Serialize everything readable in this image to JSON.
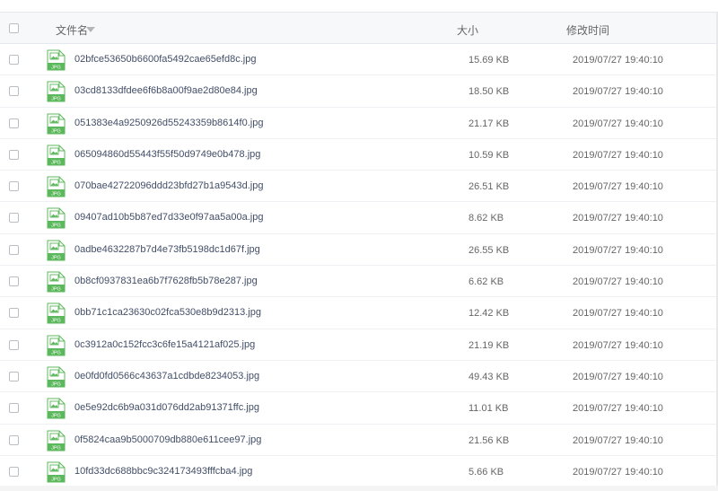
{
  "header": {
    "name_label": "文件名",
    "size_label": "大小",
    "time_label": "修改时间"
  },
  "icon": {
    "name": "jpg-file-icon",
    "badge": "JPG",
    "color": "#5cb85c"
  },
  "files": [
    {
      "name": "02bfce53650b6600fa5492cae65efd8c.jpg",
      "size": "15.69 KB",
      "time": "2019/07/27 19:40:10"
    },
    {
      "name": "03cd8133dfdee6f6b8a00f9ae2d80e84.jpg",
      "size": "18.50 KB",
      "time": "2019/07/27 19:40:10"
    },
    {
      "name": "051383e4a9250926d55243359b8614f0.jpg",
      "size": "21.17 KB",
      "time": "2019/07/27 19:40:10"
    },
    {
      "name": "065094860d55443f55f50d9749e0b478.jpg",
      "size": "10.59 KB",
      "time": "2019/07/27 19:40:10"
    },
    {
      "name": "070bae42722096ddd23bfd27b1a9543d.jpg",
      "size": "26.51 KB",
      "time": "2019/07/27 19:40:10"
    },
    {
      "name": "09407ad10b5b87ed7d33e0f97aa5a00a.jpg",
      "size": "8.62 KB",
      "time": "2019/07/27 19:40:10"
    },
    {
      "name": "0adbe4632287b7d4e73fb5198dc1d67f.jpg",
      "size": "26.55 KB",
      "time": "2019/07/27 19:40:10"
    },
    {
      "name": "0b8cf0937831ea6b7f7628fb5b78e287.jpg",
      "size": "6.62 KB",
      "time": "2019/07/27 19:40:10"
    },
    {
      "name": "0bb71c1ca23630c02fca530e8b9d2313.jpg",
      "size": "12.42 KB",
      "time": "2019/07/27 19:40:10"
    },
    {
      "name": "0c3912a0c152fcc3c6fe15a4121af025.jpg",
      "size": "21.19 KB",
      "time": "2019/07/27 19:40:10"
    },
    {
      "name": "0e0fd0fd0566c43637a1cdbde8234053.jpg",
      "size": "49.43 KB",
      "time": "2019/07/27 19:40:10"
    },
    {
      "name": "0e5e92dc6b9a031d076dd2ab91371ffc.jpg",
      "size": "11.01 KB",
      "time": "2019/07/27 19:40:10"
    },
    {
      "name": "0f5824caa9b5000709db880e611cee97.jpg",
      "size": "21.56 KB",
      "time": "2019/07/27 19:40:10"
    },
    {
      "name": "10fd33dc688bbc9c324173493fffcba4.jpg",
      "size": "5.66 KB",
      "time": "2019/07/27 19:40:10"
    }
  ]
}
